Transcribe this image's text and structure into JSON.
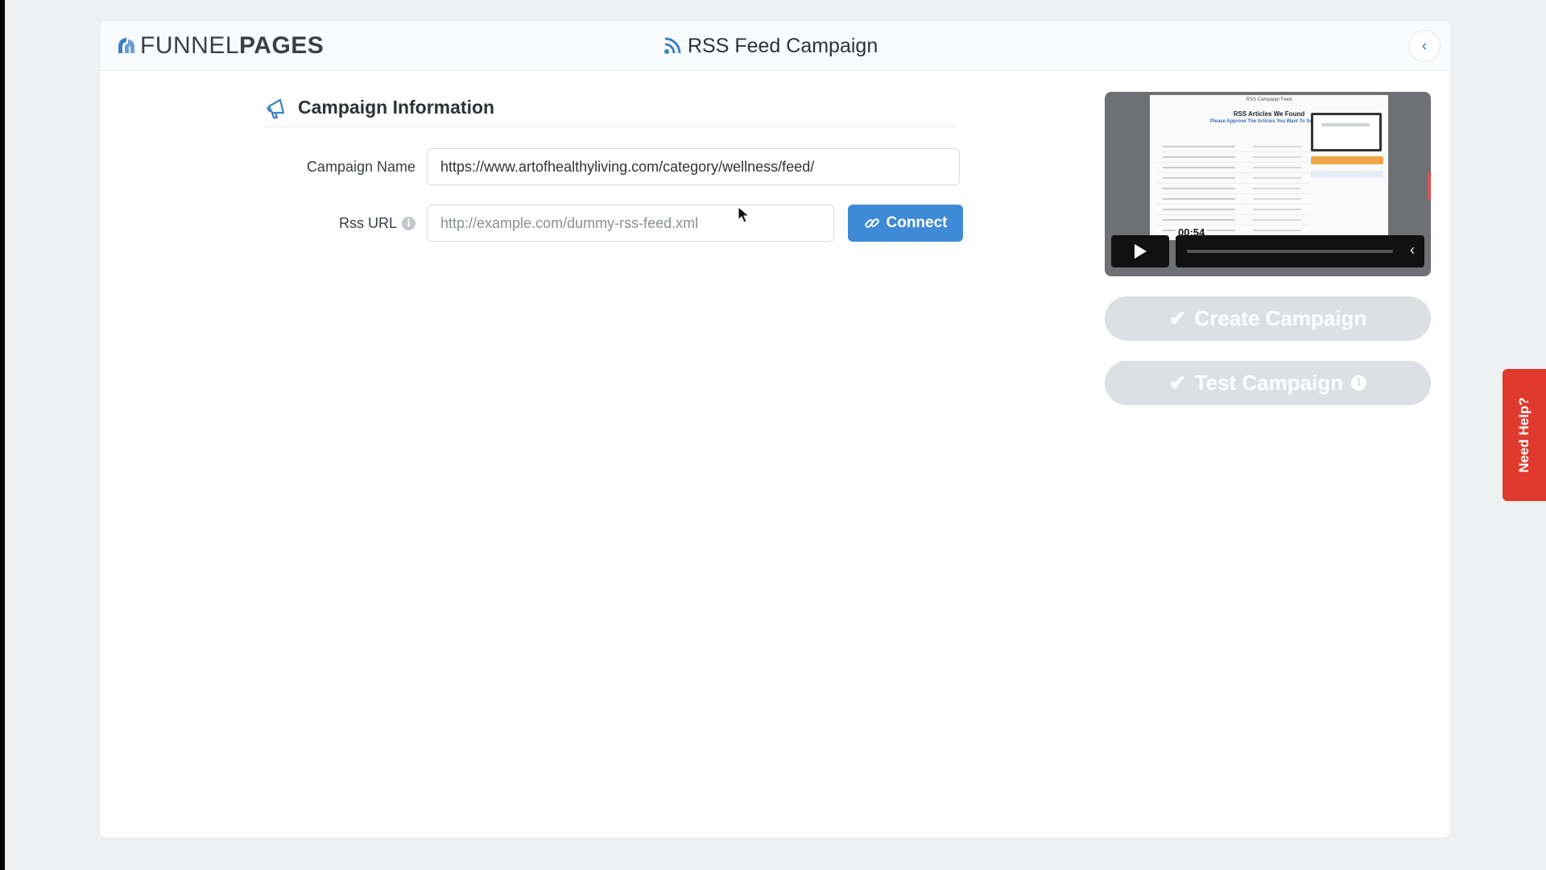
{
  "header": {
    "logo_part1": "FUNNEL",
    "logo_part2": "PAGES",
    "title": "RSS Feed Campaign"
  },
  "form": {
    "section_title": "Campaign Information",
    "campaign_name_label": "Campaign Name",
    "campaign_name_value": "https://www.artofhealthyliving.com/category/wellness/feed/",
    "rss_url_label": "Rss URL",
    "rss_url_placeholder": "http://example.com/dummy-rss-feed.xml",
    "connect_label": "Connect"
  },
  "video": {
    "time": "00:54",
    "frame_header": "RSS Campaign Feed",
    "frame_title": "RSS Articles We Found",
    "frame_subtitle": "Please Approve The Articles You Want To Schedule"
  },
  "actions": {
    "create_label": "Create Campaign",
    "test_label": "Test Campaign"
  },
  "help": {
    "label": "Need Help?"
  },
  "colors": {
    "accent": "#3f8ad6",
    "disabled_button": "#dcdfe3",
    "help_tab": "#e03a2f"
  }
}
